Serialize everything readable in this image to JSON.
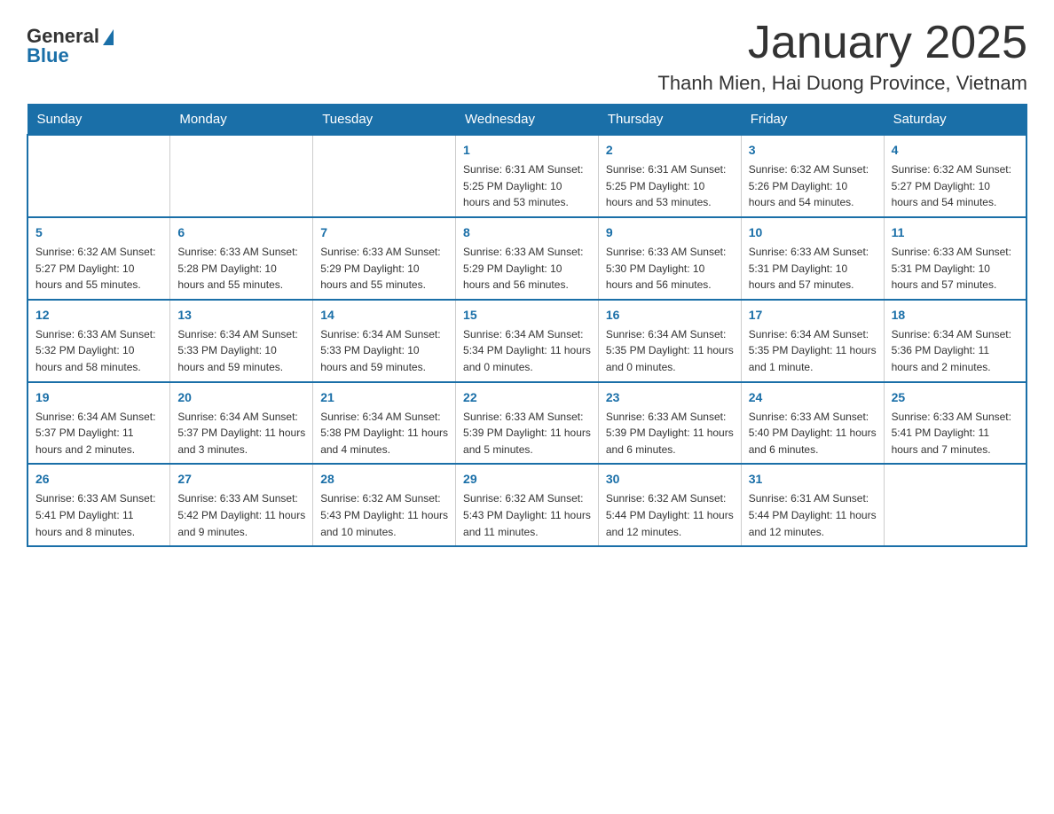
{
  "logo": {
    "general": "General",
    "blue": "Blue"
  },
  "title": "January 2025",
  "subtitle": "Thanh Mien, Hai Duong Province, Vietnam",
  "days_of_week": [
    "Sunday",
    "Monday",
    "Tuesday",
    "Wednesday",
    "Thursday",
    "Friday",
    "Saturday"
  ],
  "weeks": [
    [
      {
        "day": "",
        "info": ""
      },
      {
        "day": "",
        "info": ""
      },
      {
        "day": "",
        "info": ""
      },
      {
        "day": "1",
        "info": "Sunrise: 6:31 AM\nSunset: 5:25 PM\nDaylight: 10 hours\nand 53 minutes."
      },
      {
        "day": "2",
        "info": "Sunrise: 6:31 AM\nSunset: 5:25 PM\nDaylight: 10 hours\nand 53 minutes."
      },
      {
        "day": "3",
        "info": "Sunrise: 6:32 AM\nSunset: 5:26 PM\nDaylight: 10 hours\nand 54 minutes."
      },
      {
        "day": "4",
        "info": "Sunrise: 6:32 AM\nSunset: 5:27 PM\nDaylight: 10 hours\nand 54 minutes."
      }
    ],
    [
      {
        "day": "5",
        "info": "Sunrise: 6:32 AM\nSunset: 5:27 PM\nDaylight: 10 hours\nand 55 minutes."
      },
      {
        "day": "6",
        "info": "Sunrise: 6:33 AM\nSunset: 5:28 PM\nDaylight: 10 hours\nand 55 minutes."
      },
      {
        "day": "7",
        "info": "Sunrise: 6:33 AM\nSunset: 5:29 PM\nDaylight: 10 hours\nand 55 minutes."
      },
      {
        "day": "8",
        "info": "Sunrise: 6:33 AM\nSunset: 5:29 PM\nDaylight: 10 hours\nand 56 minutes."
      },
      {
        "day": "9",
        "info": "Sunrise: 6:33 AM\nSunset: 5:30 PM\nDaylight: 10 hours\nand 56 minutes."
      },
      {
        "day": "10",
        "info": "Sunrise: 6:33 AM\nSunset: 5:31 PM\nDaylight: 10 hours\nand 57 minutes."
      },
      {
        "day": "11",
        "info": "Sunrise: 6:33 AM\nSunset: 5:31 PM\nDaylight: 10 hours\nand 57 minutes."
      }
    ],
    [
      {
        "day": "12",
        "info": "Sunrise: 6:33 AM\nSunset: 5:32 PM\nDaylight: 10 hours\nand 58 minutes."
      },
      {
        "day": "13",
        "info": "Sunrise: 6:34 AM\nSunset: 5:33 PM\nDaylight: 10 hours\nand 59 minutes."
      },
      {
        "day": "14",
        "info": "Sunrise: 6:34 AM\nSunset: 5:33 PM\nDaylight: 10 hours\nand 59 minutes."
      },
      {
        "day": "15",
        "info": "Sunrise: 6:34 AM\nSunset: 5:34 PM\nDaylight: 11 hours\nand 0 minutes."
      },
      {
        "day": "16",
        "info": "Sunrise: 6:34 AM\nSunset: 5:35 PM\nDaylight: 11 hours\nand 0 minutes."
      },
      {
        "day": "17",
        "info": "Sunrise: 6:34 AM\nSunset: 5:35 PM\nDaylight: 11 hours\nand 1 minute."
      },
      {
        "day": "18",
        "info": "Sunrise: 6:34 AM\nSunset: 5:36 PM\nDaylight: 11 hours\nand 2 minutes."
      }
    ],
    [
      {
        "day": "19",
        "info": "Sunrise: 6:34 AM\nSunset: 5:37 PM\nDaylight: 11 hours\nand 2 minutes."
      },
      {
        "day": "20",
        "info": "Sunrise: 6:34 AM\nSunset: 5:37 PM\nDaylight: 11 hours\nand 3 minutes."
      },
      {
        "day": "21",
        "info": "Sunrise: 6:34 AM\nSunset: 5:38 PM\nDaylight: 11 hours\nand 4 minutes."
      },
      {
        "day": "22",
        "info": "Sunrise: 6:33 AM\nSunset: 5:39 PM\nDaylight: 11 hours\nand 5 minutes."
      },
      {
        "day": "23",
        "info": "Sunrise: 6:33 AM\nSunset: 5:39 PM\nDaylight: 11 hours\nand 6 minutes."
      },
      {
        "day": "24",
        "info": "Sunrise: 6:33 AM\nSunset: 5:40 PM\nDaylight: 11 hours\nand 6 minutes."
      },
      {
        "day": "25",
        "info": "Sunrise: 6:33 AM\nSunset: 5:41 PM\nDaylight: 11 hours\nand 7 minutes."
      }
    ],
    [
      {
        "day": "26",
        "info": "Sunrise: 6:33 AM\nSunset: 5:41 PM\nDaylight: 11 hours\nand 8 minutes."
      },
      {
        "day": "27",
        "info": "Sunrise: 6:33 AM\nSunset: 5:42 PM\nDaylight: 11 hours\nand 9 minutes."
      },
      {
        "day": "28",
        "info": "Sunrise: 6:32 AM\nSunset: 5:43 PM\nDaylight: 11 hours\nand 10 minutes."
      },
      {
        "day": "29",
        "info": "Sunrise: 6:32 AM\nSunset: 5:43 PM\nDaylight: 11 hours\nand 11 minutes."
      },
      {
        "day": "30",
        "info": "Sunrise: 6:32 AM\nSunset: 5:44 PM\nDaylight: 11 hours\nand 12 minutes."
      },
      {
        "day": "31",
        "info": "Sunrise: 6:31 AM\nSunset: 5:44 PM\nDaylight: 11 hours\nand 12 minutes."
      },
      {
        "day": "",
        "info": ""
      }
    ]
  ]
}
